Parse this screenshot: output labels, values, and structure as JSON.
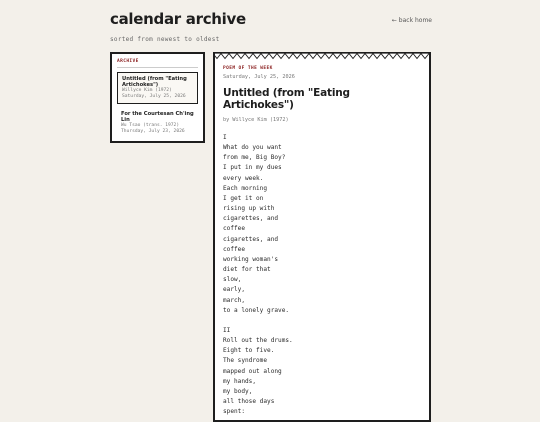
{
  "header": {
    "title": "calendar archive",
    "back_link": "← back home"
  },
  "subtitle": "sorted from newest to oldest",
  "sidebar": {
    "heading": "ARCHIVE",
    "items": [
      {
        "title": "Untitled (from \"Eating Artichokes\")",
        "author": "Willyce Kim (1972)",
        "date": "Saturday, July 25, 2026",
        "active": true
      },
      {
        "title": "For the Courtesan Ch'ing Lin",
        "author": "Wu Tsao (trans. 1972)",
        "date": "Thursday, July 23, 2026",
        "active": false
      }
    ]
  },
  "poem": {
    "label": "POEM OF THE WEEK",
    "date": "Saturday, July 25, 2026",
    "title": "Untitled (from \"Eating Artichokes\")",
    "byline": "by Willyce Kim (1972)",
    "lines": [
      "I",
      "What do you want",
      "from me, Big Boy?",
      "I put in my dues",
      "every week.",
      "Each morning",
      "I get it on",
      "rising up with",
      "cigarettes, and",
      "coffee",
      "cigarettes, and",
      "coffee",
      "working woman's",
      "diet for that",
      "slow,",
      "early,",
      "march,",
      "to a lonely grave.",
      "",
      "II",
      "Roll out the drums.",
      "Eight to five.",
      "The syndrome",
      "mapped out along",
      "my hands,",
      "my body,",
      "all those days",
      "spent:"
    ]
  }
}
